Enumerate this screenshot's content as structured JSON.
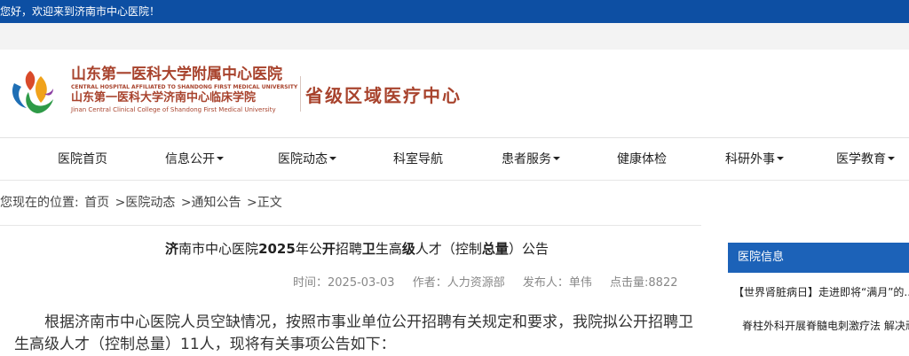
{
  "topbar": {
    "welcome": "您好，欢迎来到济南市中心医院！"
  },
  "header": {
    "name_cn": "山东第一医科大学附属中心医院",
    "name_en": "CENTRAL HOSPITAL AFFILIATED TO SHANDONG FIRST MEDICAL UNIVERSITY",
    "college_cn": "山东第一医科大学济南中心临床学院",
    "college_en": "Jinan Central Clinical College of Shandong First Medical University",
    "slogan": "省级区域医疗中心"
  },
  "nav": {
    "items": [
      {
        "label": "医院首页",
        "dropdown": false
      },
      {
        "label": "信息公开",
        "dropdown": true
      },
      {
        "label": "医院动态",
        "dropdown": true
      },
      {
        "label": "科室导航",
        "dropdown": false
      },
      {
        "label": "患者服务",
        "dropdown": true
      },
      {
        "label": "健康体检",
        "dropdown": false
      },
      {
        "label": "科研外事",
        "dropdown": true
      },
      {
        "label": "医学教育",
        "dropdown": true
      }
    ]
  },
  "breadcrumb": {
    "prefix": "您现在的位置:",
    "items": [
      "首页",
      ">医院动态",
      ">通知公告",
      ">正文"
    ]
  },
  "article": {
    "title_parts": [
      "济",
      "南市中心医院",
      "2025",
      "年公",
      "开",
      "招聘",
      "卫",
      "生高",
      "级",
      "人才（控制",
      "总量",
      "）公告"
    ],
    "meta": {
      "time": "时间：2025-03-03",
      "author": "作者：人力资源部",
      "publisher": "发布人：单伟",
      "views": "点击量:8822"
    },
    "intro": "根据济南市中心医院人员空缺情况，按照市事业单位公开招聘有关规定和要求，我院拟公开招聘卫生高级人才（控制总量）11人，现将有关事项公告如下："
  },
  "sidebar": {
    "title": "医院信息",
    "items": [
      "【世界肾脏病日】走进即将“满月”的...",
      "脊柱外科开展脊髓电刺激疗法 解决顽..."
    ]
  },
  "colors": {
    "topbar": "#0d4fa3",
    "sidebar_header": "#1c62b8",
    "logo_brand": "#a8432d"
  }
}
